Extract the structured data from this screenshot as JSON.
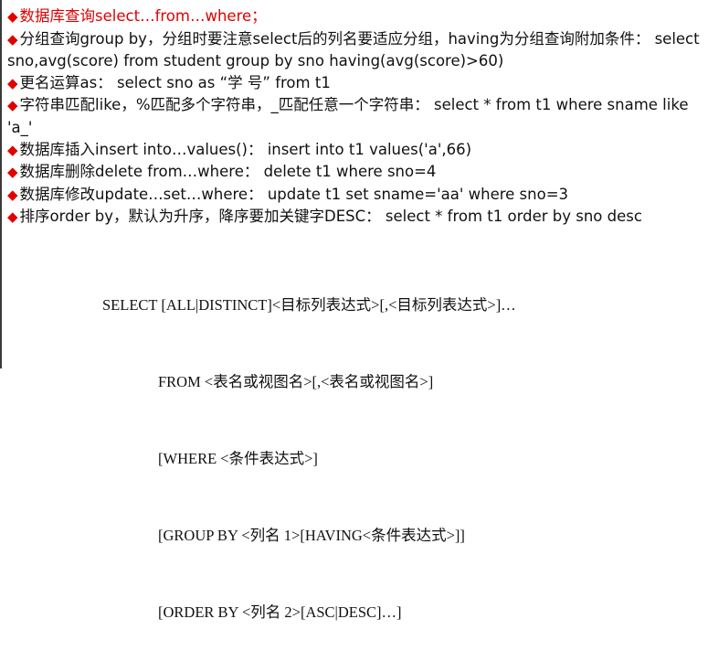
{
  "notes": [
    {
      "marker": "◆",
      "text": "数据库查询select…from…where；",
      "color": "#e00000"
    },
    {
      "marker": "◆",
      "text": "分组查询group by，分组时要注意select后的列名要适应分组，having为分组查询附加条件： select sno,avg(score) from student group by sno having(avg(score)>60)"
    },
    {
      "marker": "◆",
      "text": "更名运算as： select sno as “学 号” from t1"
    },
    {
      "marker": "◆",
      "text": "字符串匹配like，%匹配多个字符串，_匹配任意一个字符串： select * from t1 where sname like 'a_'"
    },
    {
      "marker": "◆",
      "text": "数据库插入insert into…values()： insert into t1 values('a',66)"
    },
    {
      "marker": "◆",
      "text": "数据库删除delete from…where： delete t1 where sno=4"
    },
    {
      "marker": "◆",
      "text": "数据库修改update…set…where： update t1 set sname='aa' where sno=3"
    },
    {
      "marker": "◆",
      "text": "排序order by，默认为升序，降序要加关键字DESC： select * from t1 order by sno desc"
    }
  ],
  "syntax": [
    "SELECT [ALL|DISTINCT]<目标列表达式>[,<目标列表达式>]…",
    "FROM <表名或视图名>[,<表名或视图名>]",
    "[WHERE <条件表达式>]",
    "[GROUP BY <列名 1>[HAVING<条件表达式>]]",
    "[ORDER BY <列名 2>[ASC|DESC]…]"
  ],
  "colors": {
    "marker": "#e00000",
    "highlight": "#e00000",
    "text": "#111111"
  }
}
